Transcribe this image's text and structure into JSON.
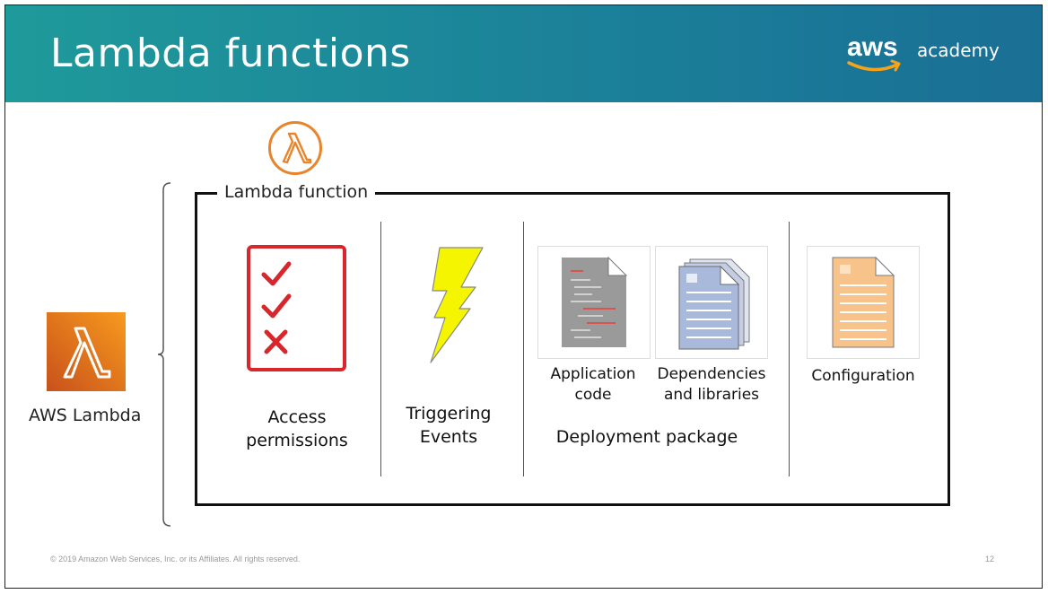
{
  "header": {
    "title": "Lambda functions",
    "logo_word": "aws",
    "logo_sub": "academy"
  },
  "left": {
    "service_label": "AWS Lambda"
  },
  "box": {
    "label": "Lambda function"
  },
  "components": {
    "access": "Access permissions",
    "triggers": "Triggering Events",
    "app_code": "Application code",
    "deps": "Dependencies and libraries",
    "package": "Deployment package",
    "config": "Configuration"
  },
  "footer": {
    "copyright": "© 2019 Amazon Web Services, Inc. or its Affiliates. All rights reserved.",
    "page_number": "12"
  },
  "icons": {
    "lambda_top": "lambda-outline-icon",
    "aws_lambda": "aws-lambda-service-icon",
    "checklist": "checklist-icon",
    "bolt": "lightning-bolt-icon",
    "code_doc": "code-document-icon",
    "deps_doc": "stacked-documents-icon",
    "config_doc": "configuration-document-icon"
  },
  "colors": {
    "header_teal": "#1f9a9a",
    "lambda_orange": "#e8842c",
    "checklist_red": "#d9262c",
    "bolt_yellow": "#f5f500",
    "doc_gray": "#9a9a9a",
    "doc_blue": "#a9b9dc",
    "doc_orange": "#f8c38b"
  }
}
